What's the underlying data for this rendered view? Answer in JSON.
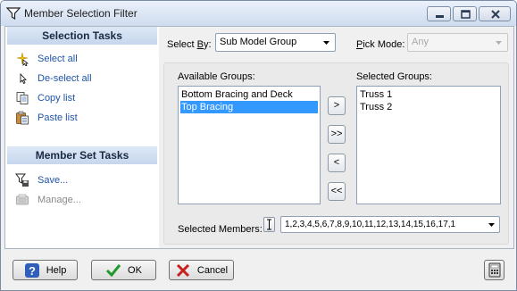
{
  "window": {
    "title": "Member Selection Filter",
    "icons": {
      "app": "filter-icon",
      "minimize": "minimize-icon",
      "maximize": "maximize-icon",
      "close": "close-icon"
    }
  },
  "taskpane": {
    "selection_header": "Selection Tasks",
    "selection_items": [
      {
        "label": "Select all",
        "icon": "select-all-icon"
      },
      {
        "label": "De-select all",
        "icon": "pointer-icon"
      },
      {
        "label": "Copy list",
        "icon": "copy-icon"
      },
      {
        "label": "Paste list",
        "icon": "paste-icon"
      }
    ],
    "member_set_header": "Member Set Tasks",
    "member_set_items": [
      {
        "label": "Save...",
        "icon": "save-filter-icon"
      },
      {
        "label": "Manage...",
        "icon": "manage-icon",
        "disabled": true
      }
    ]
  },
  "filter": {
    "select_by_prefix": "Select ",
    "select_by_underlined": "B",
    "select_by_suffix": "y:",
    "select_by_value": "Sub Model Group",
    "pick_mode_prefix": "",
    "pick_mode_underlined": "P",
    "pick_mode_suffix": "ick Mode:",
    "pick_mode_value": "Any"
  },
  "groups": {
    "available_label": "Available Groups:",
    "available": [
      {
        "label": "Bottom Bracing and Deck",
        "selected": false
      },
      {
        "label": "Top Bracing",
        "selected": true
      }
    ],
    "selected_label": "Selected Groups:",
    "selected": [
      "Truss 1",
      "Truss 2"
    ],
    "move_buttons": {
      "add": ">",
      "add_all": ">>",
      "remove": "<",
      "remove_all": "<<"
    }
  },
  "members": {
    "label": "Selected Members:",
    "value": "1,2,3,4,5,6,7,8,9,10,11,12,13,14,15,16,17,1"
  },
  "footer": {
    "help_label": "Help",
    "ok_label": "OK",
    "cancel_label": "Cancel"
  },
  "colors": {
    "task_link": "#1f54a6",
    "task_header_bg": "#c6d6ec",
    "list_selection": "#3399ff"
  }
}
